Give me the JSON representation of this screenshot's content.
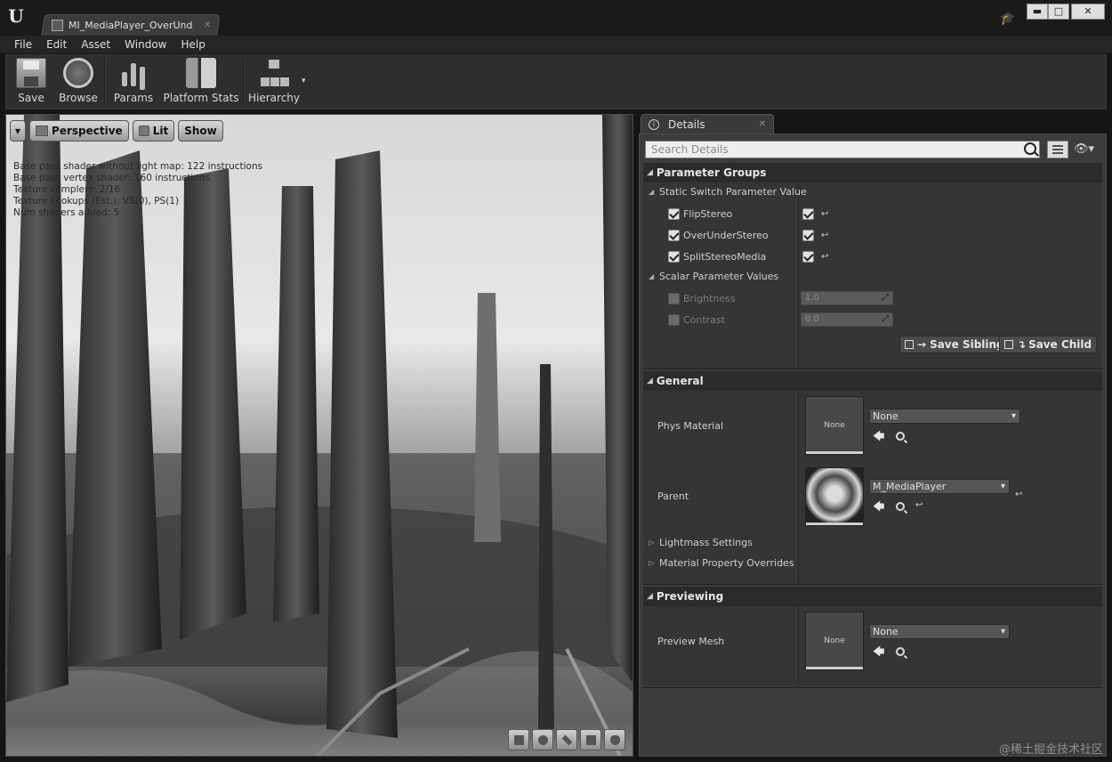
{
  "window": {
    "tab_title": "MI_MediaPlayer_OverUnd",
    "tab_close": "✕",
    "minimize": "▬",
    "maximize": "□",
    "close": "✕",
    "logo": "U"
  },
  "menu": [
    "File",
    "Edit",
    "Asset",
    "Window",
    "Help"
  ],
  "toolbar": {
    "save": "Save",
    "browse": "Browse",
    "params": "Params",
    "platform_stats": "Platform Stats",
    "hierarchy": "Hierarchy",
    "dropdown_arrow": "▾"
  },
  "viewport": {
    "perspective": "Perspective",
    "lit": "Lit",
    "show": "Show",
    "dropdown": "▾",
    "stats": [
      "Base pass shader without light map: 122 instructions",
      "Base pass vertex shader: 160 instructions",
      "Texture samplers: 2/16",
      "Texture Lookups (Est.): VS(0), PS(1)",
      "Num shaders added: 5"
    ]
  },
  "details": {
    "tab_label": "Details",
    "tab_close": "✕",
    "info_glyph": "i",
    "eye_glyph": "👁▾",
    "search_placeholder": "Search Details",
    "parameter_groups": {
      "header": "Parameter Groups",
      "static_switch": {
        "label": "Static Switch Parameter Value",
        "items": [
          {
            "name": "FlipStereo",
            "override": true,
            "value": true
          },
          {
            "name": "OverUnderStereo",
            "override": true,
            "value": true
          },
          {
            "name": "SplitStereoMedia",
            "override": true,
            "value": true
          }
        ]
      },
      "scalar": {
        "label": "Scalar Parameter Values",
        "items": [
          {
            "name": "Brightness",
            "value": "1.0"
          },
          {
            "name": "Contrast",
            "value": "0.0"
          }
        ]
      },
      "save_sibling": "Save Sibling",
      "save_child": "Save Child",
      "arrow_right": "→",
      "arrow_down": "↴"
    },
    "general": {
      "header": "General",
      "phys_material": {
        "label": "Phys Material",
        "thumb": "None",
        "value": "None"
      },
      "parent": {
        "label": "Parent",
        "value": "M_MediaPlayer"
      },
      "lightmass": "Lightmass Settings",
      "material_overrides": "Material Property Overrides"
    },
    "previewing": {
      "header": "Previewing",
      "preview_mesh": {
        "label": "Preview Mesh",
        "thumb": "None",
        "value": "None"
      }
    }
  },
  "glyphs": {
    "expanded": "◢",
    "collapsed": "▷",
    "reset": "↩",
    "use": "🡄",
    "mortarboard": "🎓"
  },
  "watermark": "@稀土掘金技术社区"
}
